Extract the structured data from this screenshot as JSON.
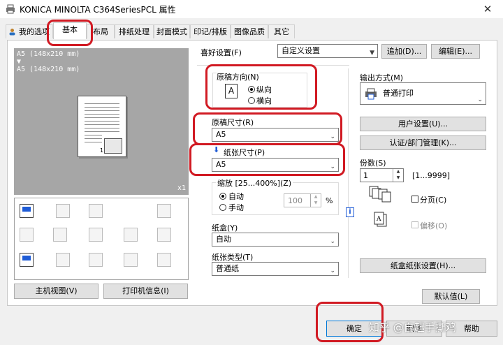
{
  "window": {
    "title": "KONICA MINOLTA C364SeriesPCL 属性",
    "close_glyph": "✕"
  },
  "tabs": [
    {
      "label": "我的选项"
    },
    {
      "label": "基本"
    },
    {
      "label": "布局"
    },
    {
      "label": "排纸处理"
    },
    {
      "label": "封面模式"
    },
    {
      "label": "印记/排版"
    },
    {
      "label": "图像品质"
    },
    {
      "label": "其它"
    }
  ],
  "preview": {
    "original_size_line": "A5 (148x210 mm)",
    "arrow_glyph": "▼",
    "paper_size_line": "A5 (148x210 mm)",
    "copies_marker": "x1",
    "page_number": "1"
  },
  "buttons": {
    "printer_view": "主机视图(V)",
    "printer_info": "打印机信息(I)",
    "add": "追加(D)...",
    "edit": "编辑(E)...",
    "user_settings": "用户设置(U)...",
    "auth": "认证/部门管理(K)...",
    "tray_paper": "纸盒纸张设置(H)...",
    "default": "默认值(L)",
    "ok": "确定",
    "cancel": "取消",
    "help": "帮助"
  },
  "favorites": {
    "label": "喜好设置(F)",
    "value": "自定义设置"
  },
  "orientation": {
    "label": "原稿方向(N)",
    "icon_letter": "A",
    "portrait": "纵向",
    "landscape": "横向",
    "selected": "portrait"
  },
  "original_size": {
    "label": "原稿尺寸(R)",
    "value": "A5"
  },
  "paper_size": {
    "label": "纸张尺寸(P)",
    "value": "A5"
  },
  "zoom": {
    "label": "缩放 [25...400%](Z)",
    "auto": "自动",
    "manual": "手动",
    "value": "100",
    "unit": "%"
  },
  "tray": {
    "label": "纸盒(Y)",
    "value": "自动"
  },
  "paper_type": {
    "label": "纸张类型(T)",
    "value": "普通纸"
  },
  "output": {
    "label": "输出方式(M)",
    "value": "普通打印"
  },
  "copies": {
    "label": "份数(S)",
    "value": "1",
    "range": "[1...9999]",
    "collate": "分页(C)",
    "offset": "偏移(O)"
  },
  "info_icon_glyph": "i",
  "watermark": "知乎 @自起手撕鸡",
  "colors": {
    "highlight": "#d11a23",
    "accent": "#1e5bd6"
  }
}
